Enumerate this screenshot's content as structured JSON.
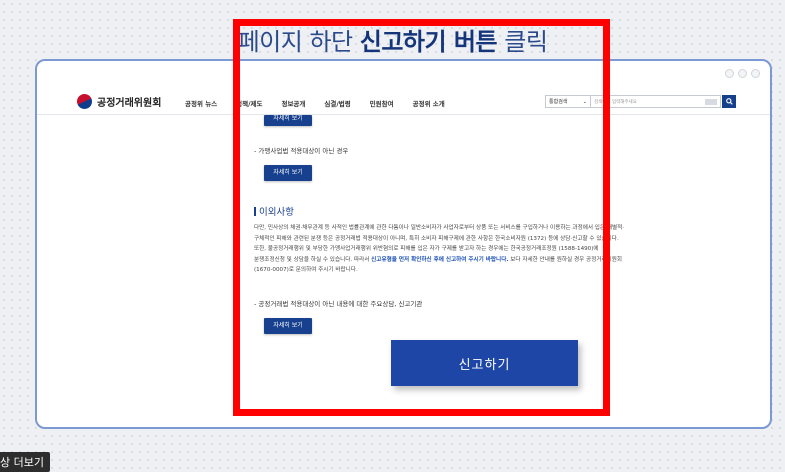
{
  "headline": {
    "prefix": "페이지 하단",
    "emphasis": "신고하기 버튼",
    "suffix": "클릭"
  },
  "site": {
    "logo": "공정거래위원회",
    "menu": [
      "공정위 뉴스",
      "정책/제도",
      "정보공개",
      "심결/법령",
      "민원참여",
      "공정위 소개"
    ],
    "search": {
      "category": "통합검색",
      "placeholder": "검색어를 입력해주세요"
    }
  },
  "content": {
    "top_button": "자세히 보기",
    "item1": "- 가맹사업법 적용대상이 아닌 경우",
    "item1_button": "자세히 보기",
    "section_title": "이외사항",
    "para": {
      "l1": "다만, 민사상의 채권·채무관계 등 사적인 법률관계에 관한 다툼이나 일반소비자가 사업자로부터 상품 또는 서비스를 구입하거나 이용하는 과정에서 입은 개별적·",
      "l2": "구체적인 피해와 관련된 분쟁 등은 공정거래법 적용대상이 아니며, 특히 소비자 피해구제에 관한 사항은 한국소비자원 (1372) 등에 상담·신고할 수 있습니다.",
      "l3": "또한, 불공정거래행위 및 부당한 가맹사업거래행위 위반혐의로 피해를 입은 자가 구제를 받고자 하는 경우에는 한국공정거래조정원 (1588-1490)에",
      "l4_before": "분쟁조정신청 및 상담을 하실 수 있습니다. 따라서 ",
      "l4_highlight": "신고유형을 먼저 확인하신 후에 신고하여 주시기 바랍니다.",
      "l4_after": " 보다 자세한 안내를 원하실 경우 공정거래위원회",
      "l5": "(1670-0007)로 문의하여 주시기 바랍니다."
    },
    "item2": "- 공정거래법 적용대상이 아닌 내용에 대한 주요상담, 신고기관",
    "item2_button": "자세히 보기",
    "report_button": "신고하기"
  },
  "overlay": {
    "more_button": "상 더보기"
  },
  "colors": {
    "highlight_border": "#ff0000",
    "primary": "#1d46a6",
    "frame": "#7b9ad4"
  }
}
